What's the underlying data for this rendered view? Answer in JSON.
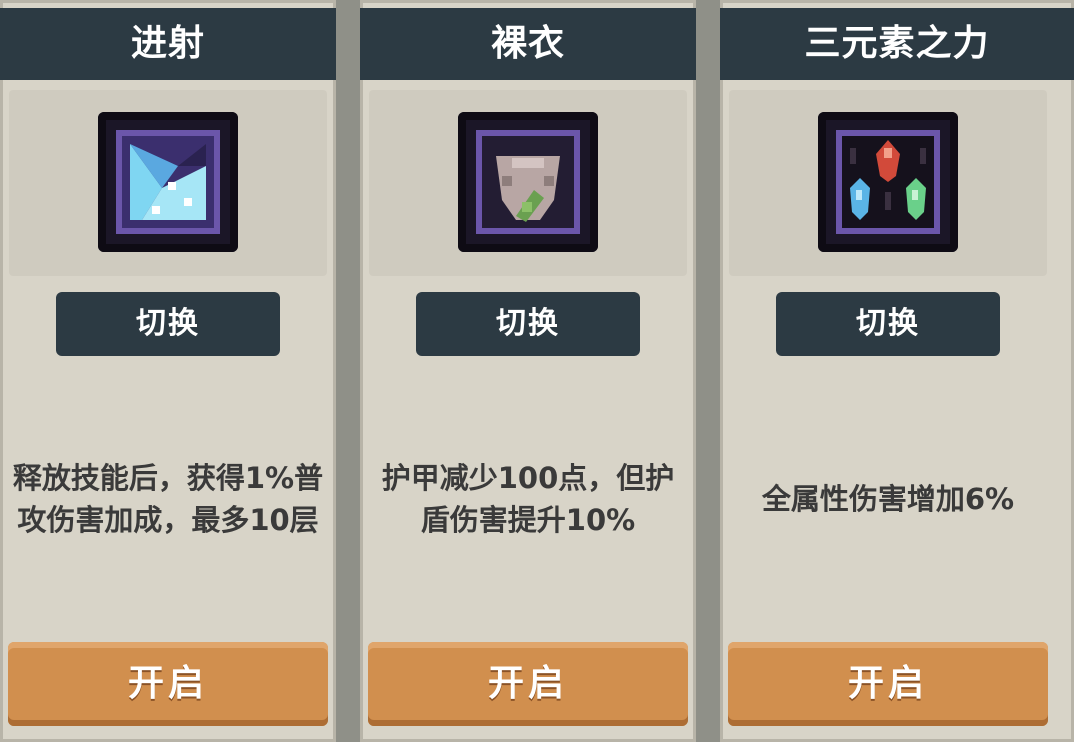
{
  "cards": [
    {
      "title": "进射",
      "icon": "arrow-burst-icon",
      "switch_label": "切换",
      "description": "释放技能后，获得1%普攻伤害加成，最多10层",
      "open_label": "开启"
    },
    {
      "title": "裸衣",
      "icon": "bare-armor-icon",
      "switch_label": "切换",
      "description": "护甲减少100点，但护盾伤害提升10%",
      "open_label": "开启"
    },
    {
      "title": "三元素之力",
      "icon": "three-elements-icon",
      "switch_label": "切换",
      "description": "全属性伤害增加6%",
      "open_label": "开启"
    }
  ],
  "colors": {
    "header": "#2c3a43",
    "card": "#d8d4c8",
    "open_button": "#d18f4e",
    "text": "#3a3a3a"
  }
}
